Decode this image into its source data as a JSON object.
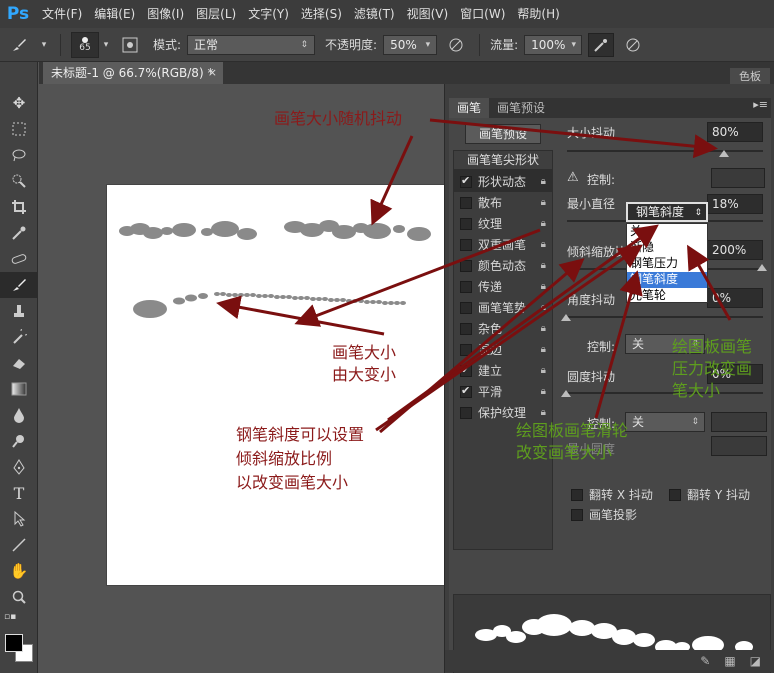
{
  "app": {
    "logo": "Ps",
    "menu": [
      "文件(F)",
      "编辑(E)",
      "图像(I)",
      "图层(L)",
      "文字(Y)",
      "选择(S)",
      "滤镜(T)",
      "视图(V)",
      "窗口(W)",
      "帮助(H)"
    ]
  },
  "options": {
    "brush_size": "65",
    "mode_label": "模式:",
    "mode_value": "正常",
    "opacity_label": "不透明度:",
    "opacity_value": "50%",
    "flow_label": "流量:",
    "flow_value": "100%"
  },
  "document": {
    "tab_title": "未标题-1 @ 66.7%(RGB/8) *",
    "close": "×"
  },
  "panel": {
    "extra_tab": "色板",
    "tabs": [
      "画笔",
      "画笔预设"
    ],
    "preset_button": "画笔预设",
    "tip_shape": "画笔笔尖形状",
    "items": [
      {
        "label": "形状动态",
        "checked": true
      },
      {
        "label": "散布",
        "checked": false
      },
      {
        "label": "纹理",
        "checked": false
      },
      {
        "label": "双重画笔",
        "checked": false
      },
      {
        "label": "颜色动态",
        "checked": false
      },
      {
        "label": "传递",
        "checked": false
      },
      {
        "label": "画笔笔势",
        "checked": false
      },
      {
        "label": "杂色",
        "checked": false
      },
      {
        "label": "湿边",
        "checked": false
      },
      {
        "label": "建立",
        "checked": true
      },
      {
        "label": "平滑",
        "checked": true
      },
      {
        "label": "保护纹理",
        "checked": false
      }
    ],
    "size_jitter_label": "大小抖动",
    "size_jitter_value": "80%",
    "control_label": "控制:",
    "control_value": "钢笔斜度",
    "dropdown_options": [
      "关",
      "渐隐",
      "钢笔压力",
      "钢笔斜度",
      "光笔轮"
    ],
    "dropdown_highlight": 3,
    "min_diameter_label": "最小直径",
    "min_diameter_value": "18%",
    "tilt_scale_label": "倾斜缩放比例",
    "tilt_scale_value": "200%",
    "angle_jitter_label": "角度抖动",
    "angle_jitter_value": "0%",
    "control2_label": "控制:",
    "control2_value": "关",
    "roundness_label": "圆度抖动",
    "roundness_value": "0%",
    "control3_label": "控制:",
    "control3_value": "关",
    "min_roundness_label": "最小圆度",
    "flip_x": "翻转 X 抖动",
    "flip_y": "翻转 Y 抖动",
    "brush_projection": "画笔投影"
  },
  "annotations": {
    "a1": "画笔大小随机抖动",
    "a2_line1": "画笔大小",
    "a2_line2": "由大变小",
    "a3_line1": "钢笔斜度可以设置",
    "a3_line2": "倾斜缩放比例",
    "a3_line3": "以改变画笔大小",
    "g1_line1": "绘图板画笔",
    "g1_line2": "压力改变画",
    "g1_line3": "笔大小",
    "g2_line1": "绘图板画笔滑轮",
    "g2_line2": "改变画笔大小"
  },
  "colors": {
    "annotation_red": "#8b1a1a",
    "annotation_green": "#5e9e1e",
    "dropdown_highlight": "#3a7ad8"
  }
}
